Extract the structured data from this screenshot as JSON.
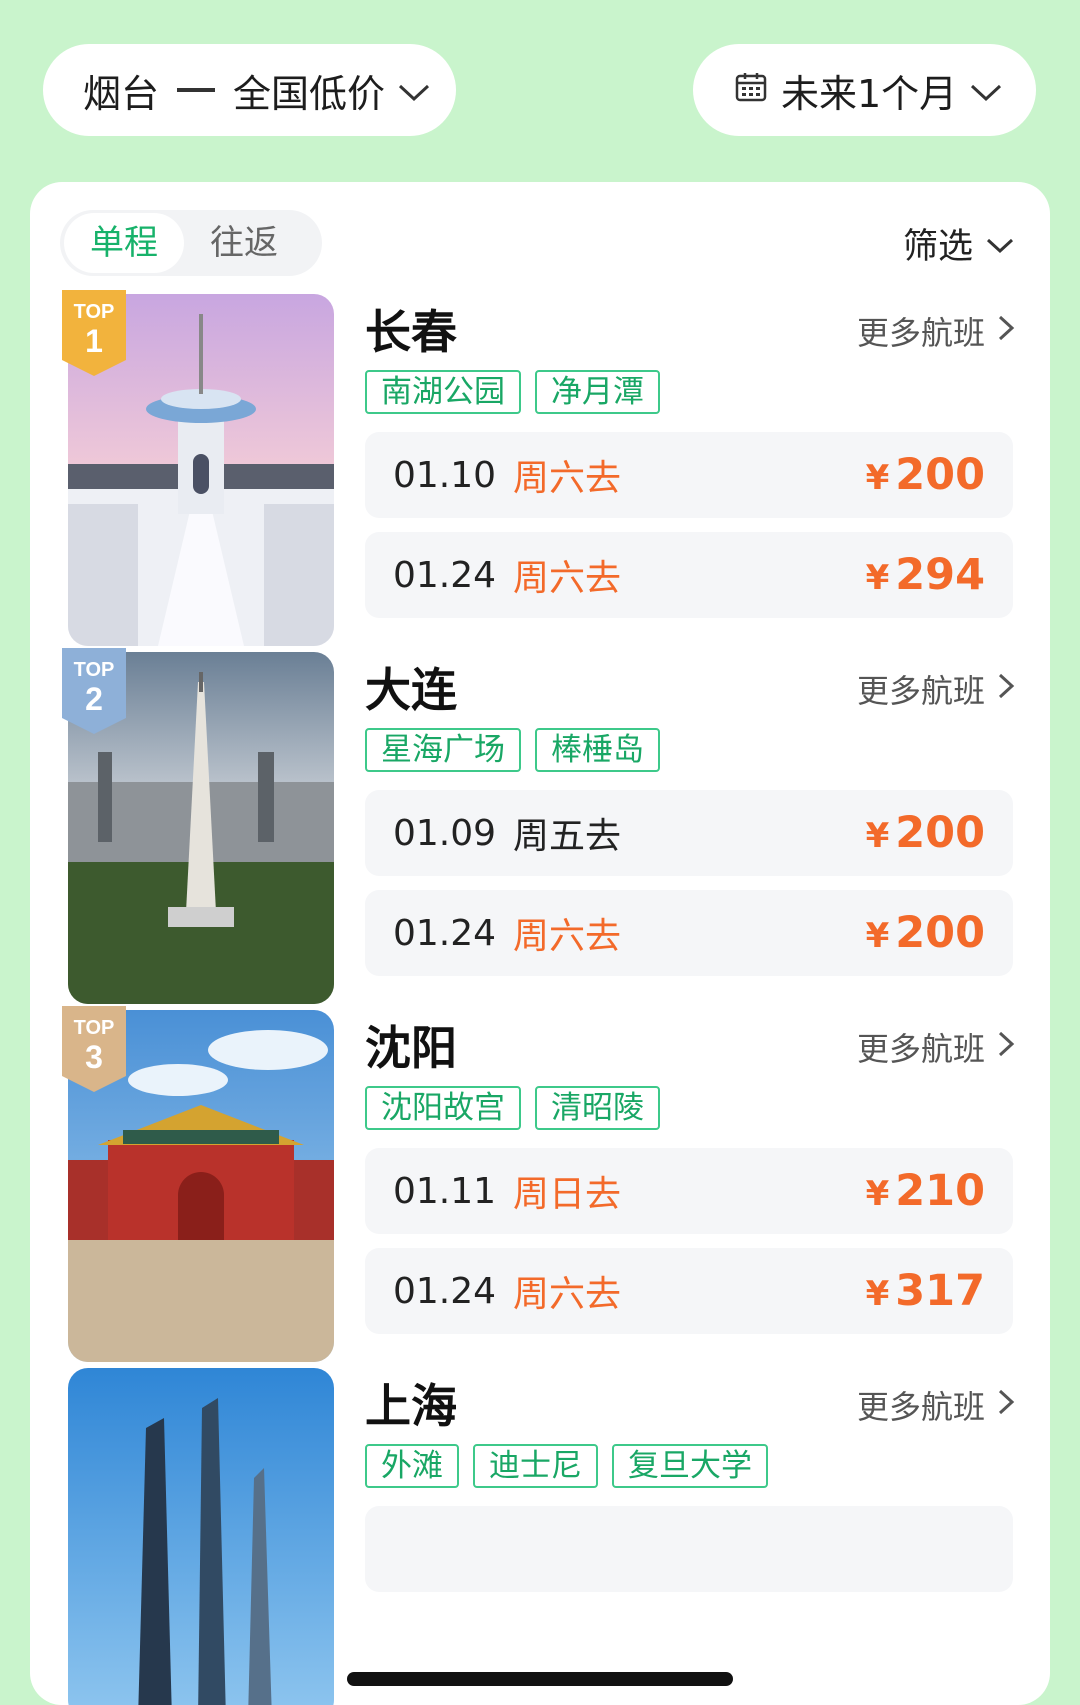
{
  "route": {
    "origin": "烟台",
    "destination_label": "全国低价"
  },
  "date_filter": {
    "label": "未来1个月"
  },
  "trip_type": {
    "tabs": [
      "单程",
      "往返"
    ],
    "active": "单程"
  },
  "filter_label": "筛选",
  "more_flights_label": "更多航班",
  "destinations": [
    {
      "rank_label": "TOP",
      "rank": "1",
      "name": "长春",
      "tags": [
        "南湖公园",
        "净月潭"
      ],
      "flights": [
        {
          "date": "01.10",
          "day": "周六去",
          "currency": "¥",
          "price": "200"
        },
        {
          "date": "01.24",
          "day": "周六去",
          "currency": "¥",
          "price": "294"
        }
      ]
    },
    {
      "rank_label": "TOP",
      "rank": "2",
      "name": "大连",
      "tags": [
        "星海广场",
        "棒棰岛"
      ],
      "flights": [
        {
          "date": "01.09",
          "day": "周五去",
          "currency": "¥",
          "price": "200"
        },
        {
          "date": "01.24",
          "day": "周六去",
          "currency": "¥",
          "price": "200"
        }
      ]
    },
    {
      "rank_label": "TOP",
      "rank": "3",
      "name": "沈阳",
      "tags": [
        "沈阳故宫",
        "清昭陵"
      ],
      "flights": [
        {
          "date": "01.11",
          "day": "周日去",
          "currency": "¥",
          "price": "210"
        },
        {
          "date": "01.24",
          "day": "周六去",
          "currency": "¥",
          "price": "317"
        }
      ]
    },
    {
      "name": "上海",
      "tags": [
        "外滩",
        "迪士尼",
        "复旦大学"
      ]
    }
  ],
  "colors": {
    "accent_green": "#17b26a",
    "price_orange": "#f36a2a",
    "background": "#c9f4cc"
  }
}
